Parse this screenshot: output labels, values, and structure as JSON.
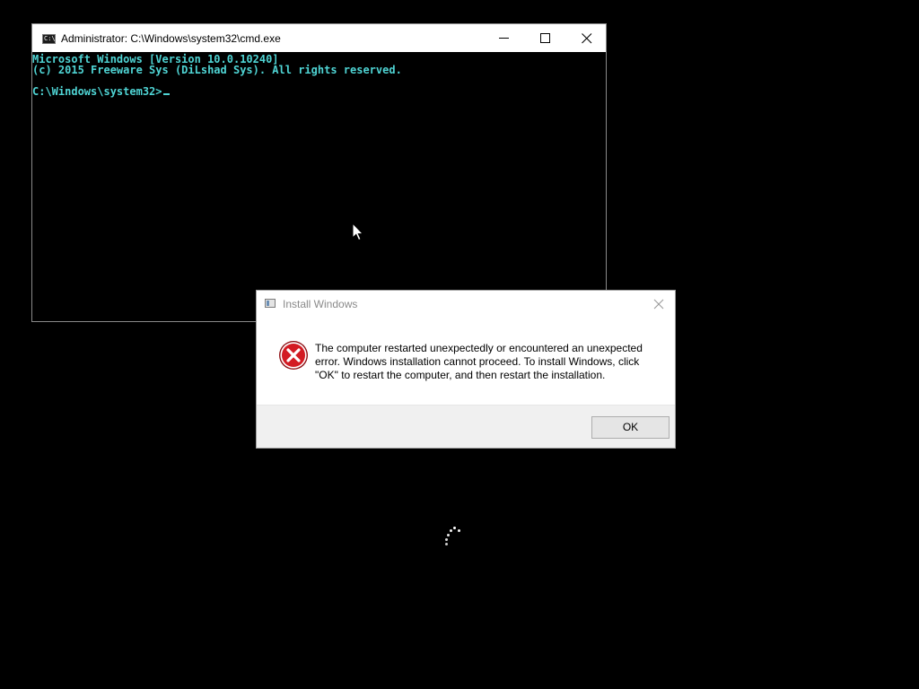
{
  "cmd_window": {
    "title": "Administrator: C:\\Windows\\system32\\cmd.exe",
    "icon": "cmd-app-icon",
    "icon_glyph": "C:\\",
    "controls": {
      "minimize": "minimize-icon",
      "maximize": "maximize-icon",
      "close": "close-icon"
    },
    "console_lines": [
      "Microsoft Windows [Version 10.0.10240]",
      "(c) 2015 Freeware Sys (DiLshad Sys). All rights reserved."
    ],
    "prompt": "C:\\Windows\\system32>",
    "text_color": "#4fd4d4",
    "background_color": "#000000"
  },
  "dialog": {
    "title": "Install Windows",
    "icon": "error-icon",
    "message": "The computer restarted unexpectedly or encountered an unexpected error. Windows installation cannot proceed. To install Windows, click \"OK\" to restart the computer, and then restart the installation.",
    "ok_label": "OK",
    "close_icon": "close-icon",
    "error_color": "#d31b23"
  },
  "desktop": {
    "background_color": "#000000",
    "spinner": "loading-spinner-icon",
    "pointer": "mouse-pointer-icon"
  }
}
